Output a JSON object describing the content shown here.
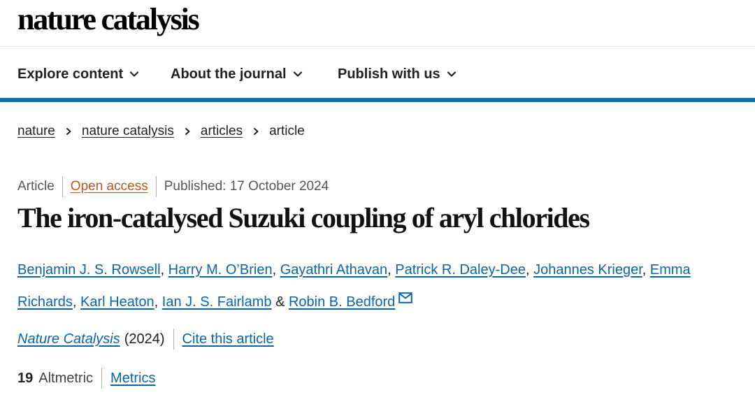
{
  "site": {
    "logo_text": "nature catalysis"
  },
  "nav": {
    "items": [
      {
        "label": "Explore content"
      },
      {
        "label": "About the journal"
      },
      {
        "label": "Publish with us"
      }
    ],
    "accent_color": "#0b6fb0"
  },
  "breadcrumb": {
    "items": [
      "nature",
      "nature catalysis",
      "articles"
    ],
    "current": "article"
  },
  "article": {
    "type": "Article",
    "access": "Open access",
    "published": "Published: 17 October 2024",
    "title": "The iron-catalysed Suzuki coupling of aryl chlorides",
    "authors": [
      "Benjamin J. S. Rowsell",
      "Harry M. O’Brien",
      "Gayathri Athavan",
      "Patrick R. Daley-Dee",
      "Johannes Krieger",
      "Emma Richards",
      "Karl Heaton",
      "Ian J. S. Fairlamb",
      "Robin B. Bedford"
    ],
    "author_separator": ", ",
    "author_last_joiner": " & ",
    "corresponding_icon": "envelope-icon"
  },
  "citation": {
    "journal": "Nature Catalysis",
    "year": "(2024)",
    "cite_label": "Cite this article"
  },
  "metrics": {
    "altmetric_count": "19",
    "altmetric_label": "Altmetric",
    "metrics_label": "Metrics"
  },
  "colors": {
    "link": "#0b63a8",
    "open_access": "#c0541b"
  }
}
